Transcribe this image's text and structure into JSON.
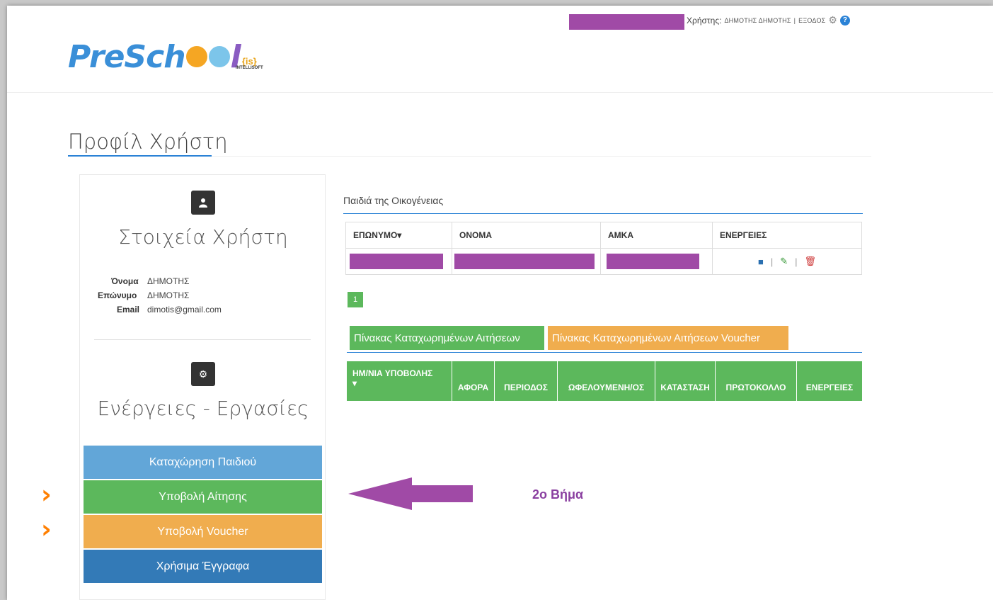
{
  "header": {
    "user_label": "Χρήστης:",
    "user_name": "ΔΗΜΟΤΗΣ ΔΗΜΟΤΗΣ",
    "separator": "|",
    "logout": "ΕΞΟΔΟΣ",
    "help": "?"
  },
  "logo": {
    "brand_a": "PreSch",
    "brand_b": "l",
    "partner": "{is}",
    "partner_sub": "INTELLISOFT"
  },
  "page": {
    "title": "Προφίλ Χρήστη"
  },
  "user_panel": {
    "title": "Στοιχεία Χρήστη",
    "fields": [
      {
        "key": "Όνομα",
        "value": "ΔΗΜΟΤΗΣ"
      },
      {
        "key": "Επώνυμο",
        "value": "ΔΗΜΟΤΗΣ"
      },
      {
        "key": "Email",
        "value": "dimotis@gmail.com"
      }
    ]
  },
  "actions_panel": {
    "title": "Ενέργειες - Εργασίες",
    "buttons": [
      {
        "label": "Καταχώρηση Παιδιού"
      },
      {
        "label": "Υποβολή Αίτησης"
      },
      {
        "label": "Υποβολή Voucher"
      },
      {
        "label": "Χρήσιμα Έγγραφα"
      }
    ]
  },
  "children": {
    "heading": "Παιδιά της Οικογένειας",
    "columns": [
      "ΕΠΩΝΥΜΟ▾",
      "ΟΝΟΜΑ",
      "ΑΜΚΑ",
      "ΕΝΕΡΓΕΙΕΣ"
    ],
    "action_sep": "|",
    "page": "1"
  },
  "requests": {
    "tabs": [
      "Πίνακας Καταχωρημένων Αιτήσεων",
      "Πίνακας Καταχωρημένων Αιτήσεων Voucher"
    ],
    "columns": [
      "ΗΜ/ΝΙΑ ΥΠΟΒΟΛΗΣ",
      "ΑΦΟΡΑ",
      "ΠΕΡΙΟΔΟΣ",
      "ΩΦΕΛΟΥΜΕΝΗ/ΟΣ",
      "ΚΑΤΑΣΤΑΣΗ",
      "ΠΡΩΤΟΚΟΛΛΟ",
      "ΕΝΕΡΓΕΙΕΣ"
    ],
    "sort_glyph": "▾"
  },
  "annotation": {
    "step": "2ο Βήμα",
    "arrow_color": "#a04aa6",
    "chevron_color": "#ff7f00"
  }
}
